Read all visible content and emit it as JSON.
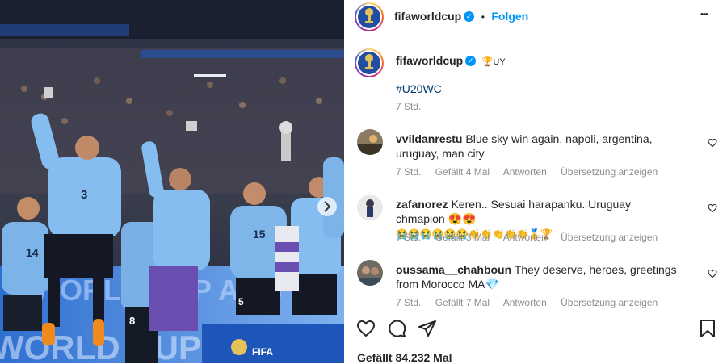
{
  "header": {
    "username": "fifaworldcup",
    "bullet": "•",
    "follow_label": "Folgen",
    "more_label": "•••"
  },
  "caption": {
    "username": "fifaworldcup",
    "suffix": "🏆UY",
    "hashtag": "#U20WC",
    "time": "7 Std."
  },
  "comments": [
    {
      "username": "vvildanrestu",
      "text": "Blue sky win again, napoli, argentina, uruguay, man city",
      "time": "7 Std.",
      "likes": "Gefällt 4 Mal",
      "reply": "Antworten",
      "translate": "Übersetzung anzeigen"
    },
    {
      "username": "zafanorez",
      "text": "Keren.. Sesuai harapanku. Uruguay chmapion 😍😍",
      "emoji_line": "😭😭😭😭😭😭👏👏👏👏👏🥇🏆",
      "time": "7 Std.",
      "likes": "Gefällt 3 Mal",
      "reply": "Antworten",
      "translate": "Übersetzung anzeigen"
    },
    {
      "username": "oussama__chahboun",
      "text": "They deserve, heroes, greetings from Morocco MA💎",
      "time": "7 Std.",
      "likes": "Gefällt 7 Mal",
      "reply": "Antworten",
      "translate": "Übersetzung anzeigen"
    }
  ],
  "likes_total": "Gefällt 84.232 Mal",
  "photo": {
    "banner_text": "WORLD CUP ARG",
    "fifa_text": "FIFA",
    "fifa_sub": "U-20 WORLD CUP",
    "jersey_numbers": [
      "3",
      "14",
      "15",
      "5",
      "8"
    ]
  },
  "colors": {
    "accent": "#0095f6",
    "uruguay_blue": "#6fa8dc",
    "navy": "#1a2a4a"
  }
}
